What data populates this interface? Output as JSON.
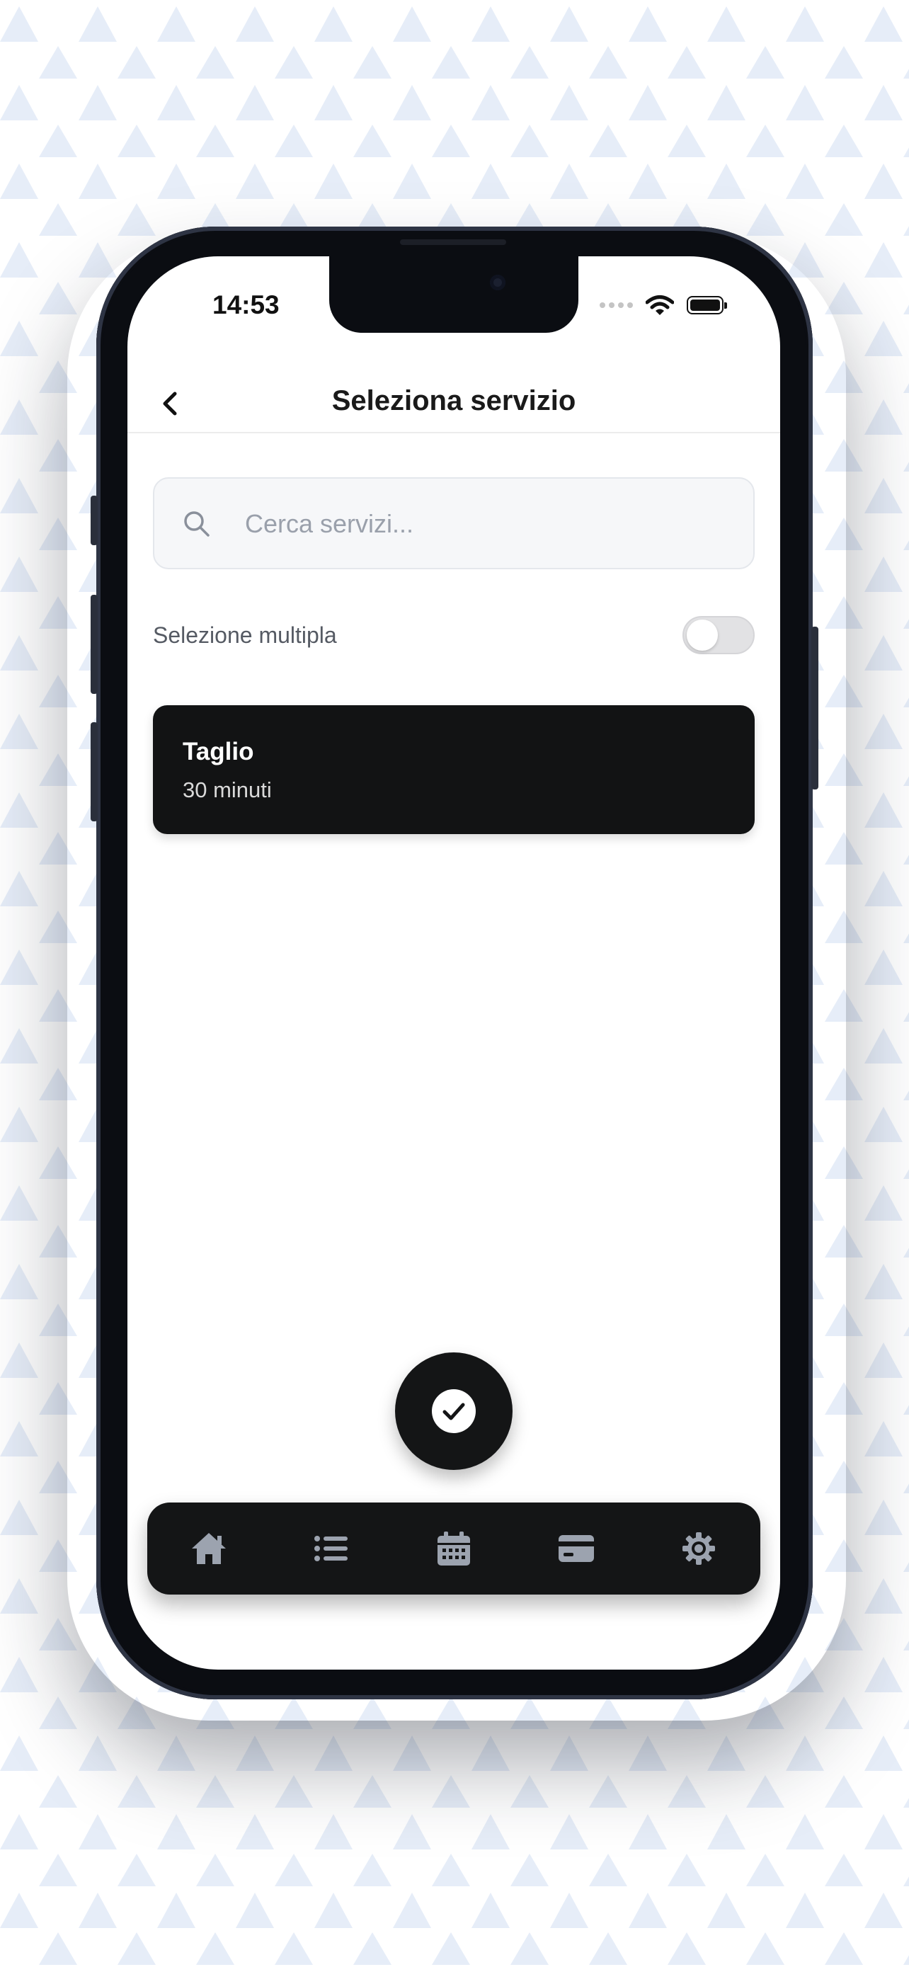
{
  "status_bar": {
    "time": "14:53"
  },
  "header": {
    "title": "Seleziona servizio",
    "back_icon": "chevron-left-icon"
  },
  "search": {
    "placeholder": "Cerca servizi...",
    "value": "",
    "icon": "search-icon"
  },
  "multi_select": {
    "label": "Selezione multipla",
    "enabled": false
  },
  "services": [
    {
      "name": "Taglio",
      "duration": "30 minuti",
      "selected": true
    }
  ],
  "fab": {
    "icon": "check-icon"
  },
  "tab_bar": {
    "items": [
      {
        "icon": "home-icon"
      },
      {
        "icon": "list-icon"
      },
      {
        "icon": "calendar-icon"
      },
      {
        "icon": "credit-card-icon"
      },
      {
        "icon": "settings-icon"
      }
    ]
  },
  "colors": {
    "card": "#121314",
    "tab_bar": "#141516",
    "pattern": "#e6edf8"
  }
}
